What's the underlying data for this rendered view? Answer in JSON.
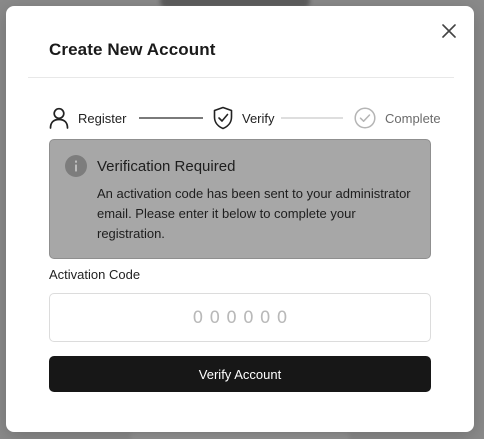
{
  "modal": {
    "title": "Create New Account",
    "close_icon": "close-icon"
  },
  "stepper": {
    "steps": [
      {
        "label": "Register",
        "icon": "user-icon",
        "state": "completed"
      },
      {
        "label": "Verify",
        "icon": "shield-check-icon",
        "state": "active"
      },
      {
        "label": "Complete",
        "icon": "check-circle-icon",
        "state": "pending"
      }
    ]
  },
  "alert": {
    "icon": "info-icon",
    "title": "Verification Required",
    "message": "An activation code has been sent to your administrator email. Please enter it below to complete your registration."
  },
  "activation": {
    "label": "Activation Code",
    "placeholder": "000000",
    "value": ""
  },
  "actions": {
    "verify_label": "Verify Account"
  },
  "colors": {
    "primary_button": "#171717",
    "alert_background": "#a7a7a7",
    "overlay": "#8a8a8a"
  }
}
